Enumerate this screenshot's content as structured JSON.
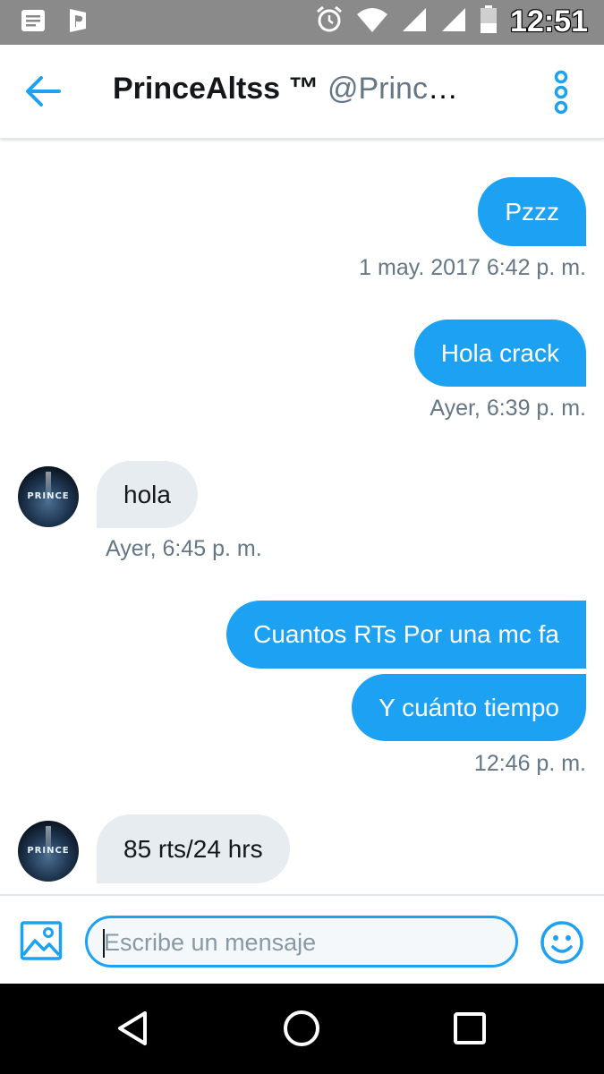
{
  "status_bar": {
    "time": "12:51",
    "icons": [
      "notification-icon",
      "app-icon",
      "alarm-icon",
      "wifi-icon",
      "signal-icon",
      "signal-icon",
      "battery-icon"
    ]
  },
  "header": {
    "name": "PrinceAltss ™",
    "handle": "@Prince…",
    "back_icon": "arrow-left-icon",
    "more_icon": "more-vertical-icon"
  },
  "messages": [
    {
      "direction": "sent",
      "text": "Pzzz",
      "timestamp": "1 may. 2017 6:42 p. m."
    },
    {
      "direction": "sent",
      "text": "Hola crack",
      "timestamp": "Ayer, 6:39 p. m."
    },
    {
      "direction": "received",
      "text": "hola",
      "timestamp": "Ayer, 6:45 p. m.",
      "avatar_text": "PRINCE"
    },
    {
      "direction": "sent",
      "text": "Cuantos RTs Por una mc fa",
      "timestamp": ""
    },
    {
      "direction": "sent",
      "text": "Y cuánto tiempo",
      "timestamp": "12:46 p. m."
    },
    {
      "direction": "received",
      "text": "85 rts/24 hrs",
      "timestamp": "",
      "avatar_text": "PRINCE"
    }
  ],
  "composer": {
    "placeholder": "Escribe un mensaje",
    "value": "",
    "image_icon": "image-icon",
    "emoji_icon": "emoji-icon"
  },
  "colors": {
    "accent": "#1da1f2",
    "received_bubble": "#e6ecf0",
    "secondary_text": "#657786",
    "status_bar": "#8a8a8a"
  }
}
